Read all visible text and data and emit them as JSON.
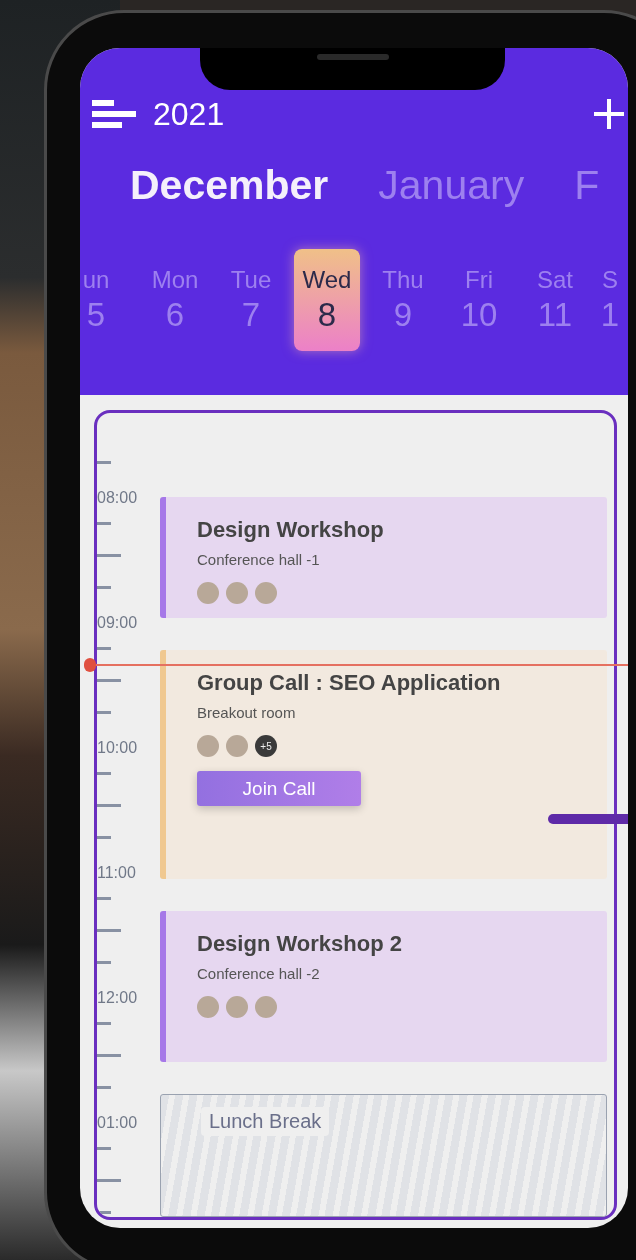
{
  "header": {
    "year": "2021"
  },
  "months": [
    {
      "label": "December",
      "selected": true
    },
    {
      "label": "January",
      "selected": false
    },
    {
      "label": "F",
      "selected": false
    }
  ],
  "days": [
    {
      "weekday": "un",
      "date": "5",
      "selected": false
    },
    {
      "weekday": "Mon",
      "date": "6",
      "selected": false
    },
    {
      "weekday": "Tue",
      "date": "7",
      "selected": false
    },
    {
      "weekday": "Wed",
      "date": "8",
      "selected": true
    },
    {
      "weekday": "Thu",
      "date": "9",
      "selected": false
    },
    {
      "weekday": "Fri",
      "date": "10",
      "selected": false
    },
    {
      "weekday": "Sat",
      "date": "11",
      "selected": false
    },
    {
      "weekday": "S",
      "date": "1",
      "selected": false
    }
  ],
  "timeline": {
    "hours": [
      "08:00",
      "09:00",
      "10:00",
      "11:00",
      "12:00",
      "01:00"
    ]
  },
  "events": [
    {
      "kind": "meeting",
      "color": "#a678e8",
      "title": "Design  Workshop",
      "location": "Conference hall -1",
      "attendees": [
        {
          "kind": "photo"
        },
        {
          "kind": "photo"
        },
        {
          "kind": "photo"
        }
      ]
    },
    {
      "kind": "call",
      "color": "#f0c890",
      "title": "Group Call : SEO Application",
      "location": "Breakout room",
      "attendees": [
        {
          "kind": "photo"
        },
        {
          "kind": "photo"
        },
        {
          "kind": "more",
          "label": "+5"
        }
      ],
      "button": "Join Call"
    },
    {
      "kind": "meeting",
      "color": "#a678e8",
      "title": "Design  Workshop 2",
      "location": "Conference hall -2",
      "attendees": [
        {
          "kind": "photo"
        },
        {
          "kind": "photo"
        },
        {
          "kind": "photo"
        }
      ]
    },
    {
      "kind": "break",
      "title": "Lunch Break"
    }
  ]
}
